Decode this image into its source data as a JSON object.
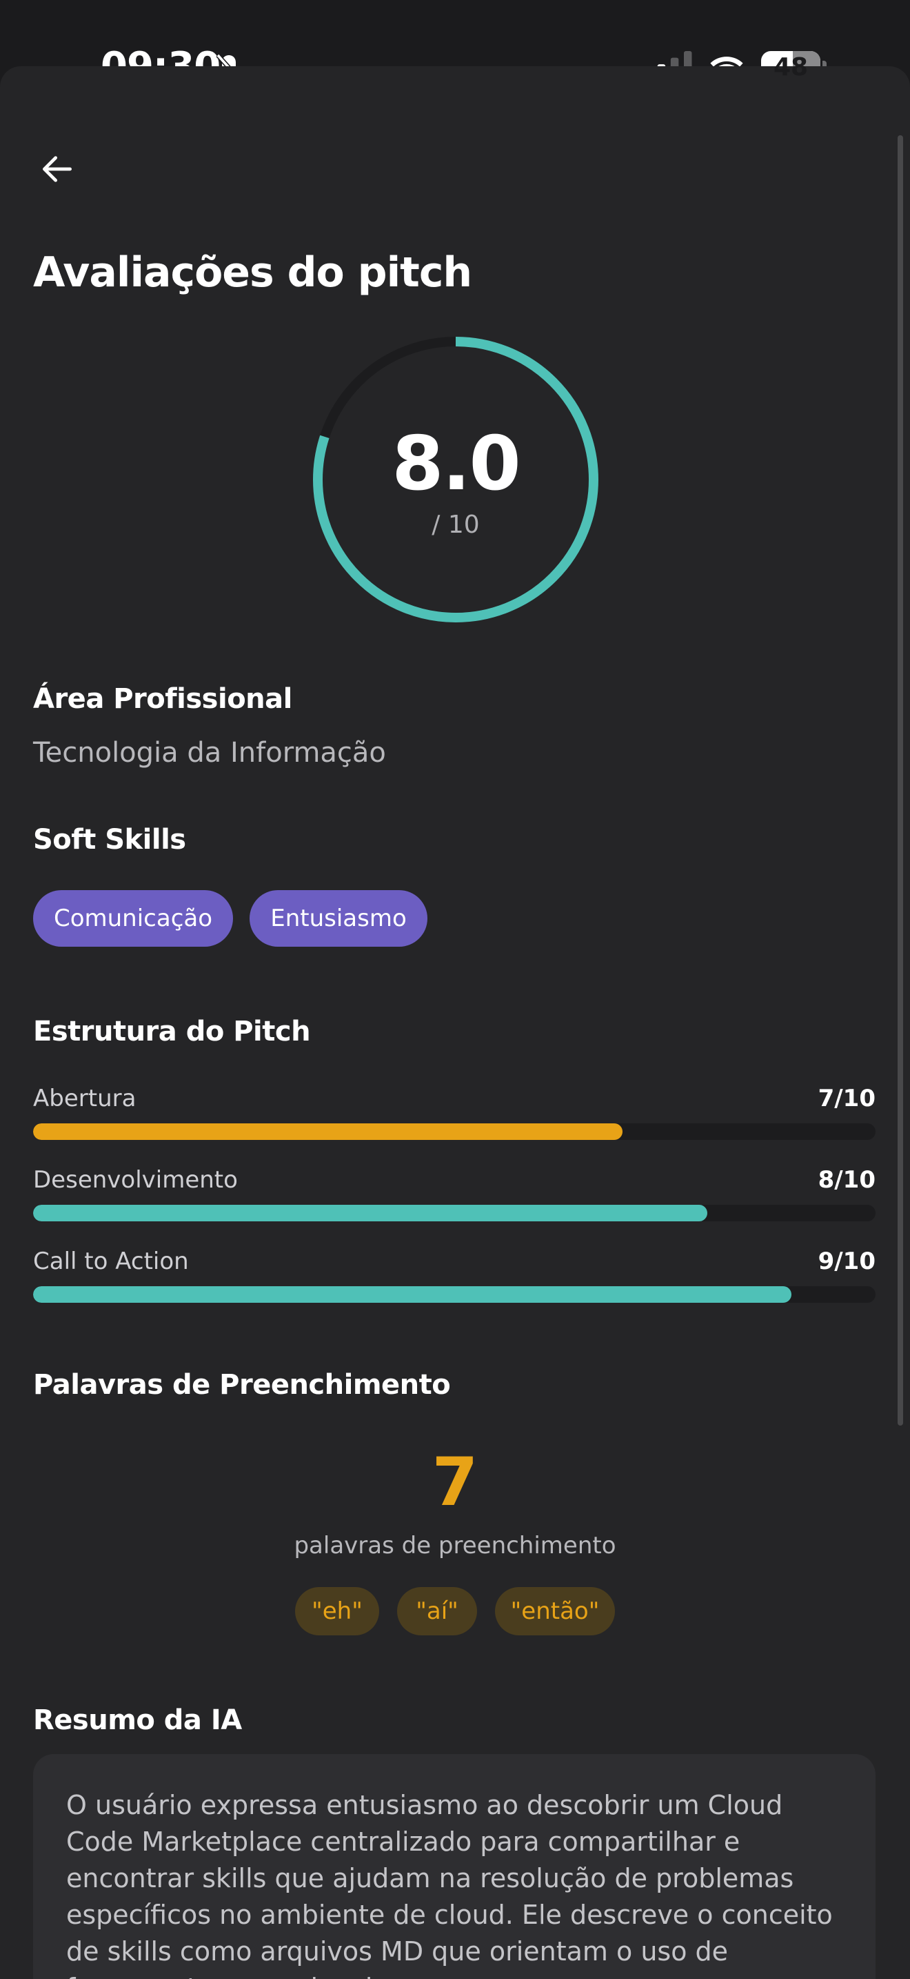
{
  "status_bar": {
    "time": "09:30",
    "battery": "48"
  },
  "header": {
    "title": "Avaliações do pitch"
  },
  "score": {
    "value": "8.0",
    "max_label": "/ 10",
    "fraction": 0.8,
    "ring_color": "#4fc1b7"
  },
  "professional_area": {
    "title": "Área Profissional",
    "value": "Tecnologia da Informação"
  },
  "soft_skills": {
    "title": "Soft Skills",
    "chips": [
      "Comunicação",
      "Entusiasmo"
    ],
    "chip_color": "#6c5ec2"
  },
  "pitch_structure": {
    "title": "Estrutura do Pitch",
    "items": [
      {
        "label": "Abertura",
        "score": "7/10",
        "value": 7,
        "color": "#e8a317"
      },
      {
        "label": "Desenvolvimento",
        "score": "8/10",
        "value": 8,
        "color": "#4fc1b7"
      },
      {
        "label": "Call to Action",
        "score": "9/10",
        "value": 9,
        "color": "#4fc1b7"
      }
    ]
  },
  "filler_words": {
    "title": "Palavras de Preenchimento",
    "count": "7",
    "caption": "palavras de preenchimento",
    "words": [
      "\"eh\"",
      "\"aí\"",
      "\"então\""
    ],
    "accent": "#e8a317"
  },
  "ai_summary": {
    "title": "Resumo da IA",
    "text": "O usuário expressa entusiasmo ao descobrir um Cloud Code Marketplace centralizado para compartilhar e encontrar skills que ajudam na resolução de problemas específicos no ambiente de cloud. Ele descreve o conceito de skills como arquivos MD que orientam o uso de ferramentas e modos de"
  }
}
